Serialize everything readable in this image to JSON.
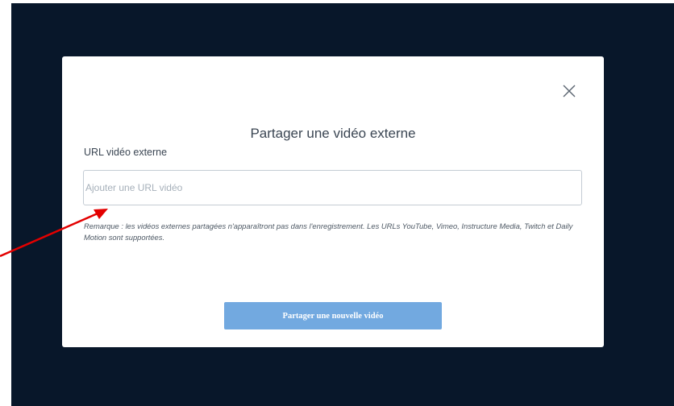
{
  "modal": {
    "title": "Partager une vidéo externe",
    "field_label": "URL vidéo externe",
    "url_input": {
      "value": "",
      "placeholder": "Ajouter une URL vidéo"
    },
    "note": "Remarque : les vidéos externes partagées n'apparaîtront pas dans l'enregistrement. Les URLs YouTube, Vimeo, Instructure Media, Twitch et Daily Motion sont supportées.",
    "share_button_label": "Partager une nouvelle vidéo",
    "close_icon": "close-icon"
  },
  "annotation": {
    "arrow_color": "#e30000"
  },
  "colors": {
    "backdrop": "#08172a",
    "button": "#72a9e0",
    "input_border": "#c4ccd4"
  }
}
